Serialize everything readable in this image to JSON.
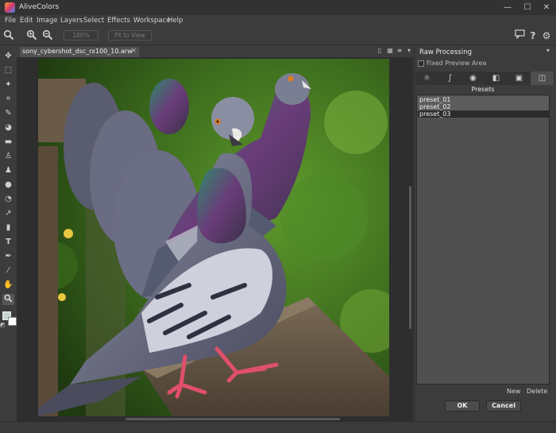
{
  "app": {
    "title": "AliveColors"
  },
  "window_controls": {
    "minimize": "—",
    "maximize": "☐",
    "close": "✕"
  },
  "menu": [
    "File",
    "Edit",
    "Image",
    "Layers",
    "Select",
    "Effects",
    "Workspace",
    "Help"
  ],
  "toolbar": {
    "zoom_100": "100%",
    "fit_to_view": "Fit to View"
  },
  "document": {
    "tab_label": "sony_cybershot_dsc_rx100_10.arw",
    "tab_close": "×"
  },
  "raw_panel": {
    "title": "Raw Processing",
    "fixed_preview_label": "Fixed Preview Area",
    "presets_header": "Presets",
    "presets": [
      "preset_01",
      "preset_02",
      "preset_03"
    ],
    "selected_preset": "preset_03",
    "new_label": "New",
    "delete_label": "Delete",
    "ok_label": "OK",
    "cancel_label": "Cancel"
  },
  "colors": {
    "bg": "#3c3c3c",
    "canvas_bg": "#2e2e2e",
    "panel_list": "#505050"
  }
}
